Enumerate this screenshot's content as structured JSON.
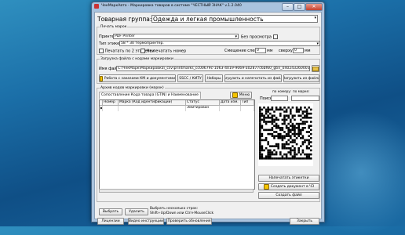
{
  "window": {
    "title": "ЧекМаркАвто - Маркировка товаров в системе \"ЧЕСТНЫЙ ЗНАК\" v.1.2.040",
    "minimize": "–",
    "maximize": "□",
    "close": "✕"
  },
  "product_group": {
    "label": "Товарная группа:",
    "value": "Одежда и легкая промышленность"
  },
  "print": {
    "section_label": "Печать марок",
    "printer_label": "Принтер:",
    "printer_value": "PDF Printer",
    "no_preview_label": "Без просмотра",
    "label_type_label": "Тип этикетки:",
    "label_type_value": "58 * 30 термопринтер.",
    "print_two_label": "Печатать по 2 этикетки",
    "no_number_label": "Не печатать номер",
    "offset_label": "Смещение слева:",
    "offset_left_value": "0",
    "offset_unit": "мм",
    "offset_top_label": "сверху:",
    "offset_top_value": "0",
    "offset_top_unit": "мм"
  },
  "load": {
    "section_label": "Загрузка файла с кодами маркировки",
    "filename_label": "Имя файла:",
    "filename_value": "C:\\ЧекМарк\\Маркировка\\_csv\\printmarks_cc00679c-1063-4019-9069-a02877c6bf60_gtin_04024326000319_quan",
    "btn_orders": "Работа с заказами КМ и документами",
    "btn_sscc": "SSCC / КИТУ",
    "btn_sets": "Наборы",
    "btn_load_print": "Загрузить и напечатать из файла",
    "btn_load_file": "Загрузить из файла"
  },
  "archive": {
    "section_label": "Архив кодов маркировки (марок)",
    "tab_label": "Сопоставление Кода товара (GTIN) и Наименование",
    "menu_label": "Меню",
    "columns": [
      "Номер",
      "Марка (Код идентификации)",
      "Статус",
      "Дата изм.",
      "Тип"
    ],
    "rows": [
      {
        "marker": "▶",
        "number": "",
        "code": "",
        "status": "Эмитирован",
        "date": "",
        "type": ""
      }
    ]
  },
  "right_panel": {
    "by_number_label": "по номеру:",
    "by_mark_label": "по марке:",
    "search_label": "Поиск:",
    "print_label_btn": "Напечатать этикетки",
    "create_doc_btn": "Создать документ в ЧЗ",
    "create_file_btn": "Создать файл"
  },
  "bottom": {
    "select_btn": "Выбрать",
    "delete_btn": "Удалить",
    "hint": "Выбрать несколько строк: Shift+Up/Down или Ctrl+MouseClick",
    "license_btn": "Лицензии",
    "video_btn": "Видео инструкции",
    "updates_btn": "Проверить обновления",
    "close_btn": "Закрыть"
  },
  "colors": {
    "desktop": "#1b6fa8",
    "window_frame": "#a9c3de",
    "client_bg": "#f0f0f0"
  }
}
